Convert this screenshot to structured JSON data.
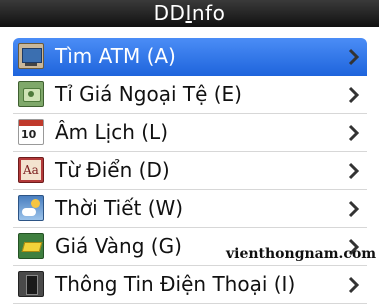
{
  "title": {
    "prefix": "DD",
    "underlined": "I",
    "suffix": "nfo"
  },
  "menu": [
    {
      "label": "Tìm ATM (A)",
      "icon": "atm-card-icon",
      "selected": true
    },
    {
      "label": "Tỉ Giá Ngoại Tệ (E)",
      "icon": "currency-note-icon",
      "selected": false
    },
    {
      "label": "Âm Lịch (L)",
      "icon": "calendar-icon",
      "icon_text": "10",
      "selected": false
    },
    {
      "label": "Từ Điển (D)",
      "icon": "dictionary-icon",
      "icon_text": "Aa",
      "selected": false
    },
    {
      "label": "Thời Tiết (W)",
      "icon": "weather-icon",
      "selected": false
    },
    {
      "label": "Giá Vàng (G)",
      "icon": "gold-bar-icon",
      "selected": false
    },
    {
      "label": "Thông Tin Điện Thoại (I)",
      "icon": "phone-info-icon",
      "selected": false
    }
  ],
  "watermark": "vienthongnam.com",
  "colors": {
    "selected": "#2f78ea",
    "titlebar": "#1a1a1a"
  }
}
